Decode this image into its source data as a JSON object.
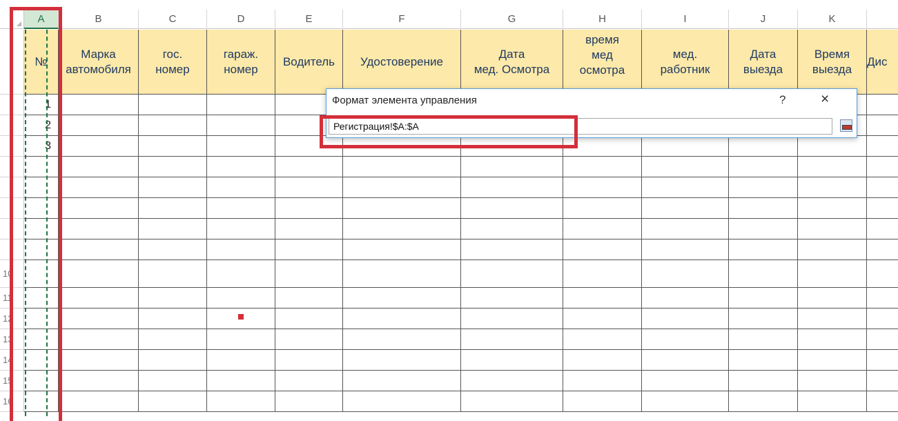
{
  "columns": [
    "A",
    "B",
    "C",
    "D",
    "E",
    "F",
    "G",
    "H",
    "I",
    "J",
    "K"
  ],
  "header_row": {
    "a": "№",
    "b": "Марка\nавтомобиля",
    "c": "гос.\nномер",
    "d": "гараж.\nномер",
    "e": "Водитель",
    "f": "Удостоверение",
    "g": "Дата\nмед. Осмотра",
    "h": "время\nмед\nосмотра",
    "i": "мед.\nработник",
    "j": "Дата\nвыезда",
    "k": "Время\nвыезда",
    "l": "Дис"
  },
  "row_numbers": [
    "10",
    "11",
    "12",
    "13",
    "14",
    "15",
    "16"
  ],
  "column_a_values": [
    "1",
    "2",
    "3"
  ],
  "dialog": {
    "title": "Формат элемента управления",
    "help": "?",
    "close": "×",
    "range_value": "Регистрация!$A:$A"
  },
  "colors": {
    "header_fill": "#fde9a9",
    "highlight_red": "#d32f3a",
    "selection_green": "#217346"
  }
}
